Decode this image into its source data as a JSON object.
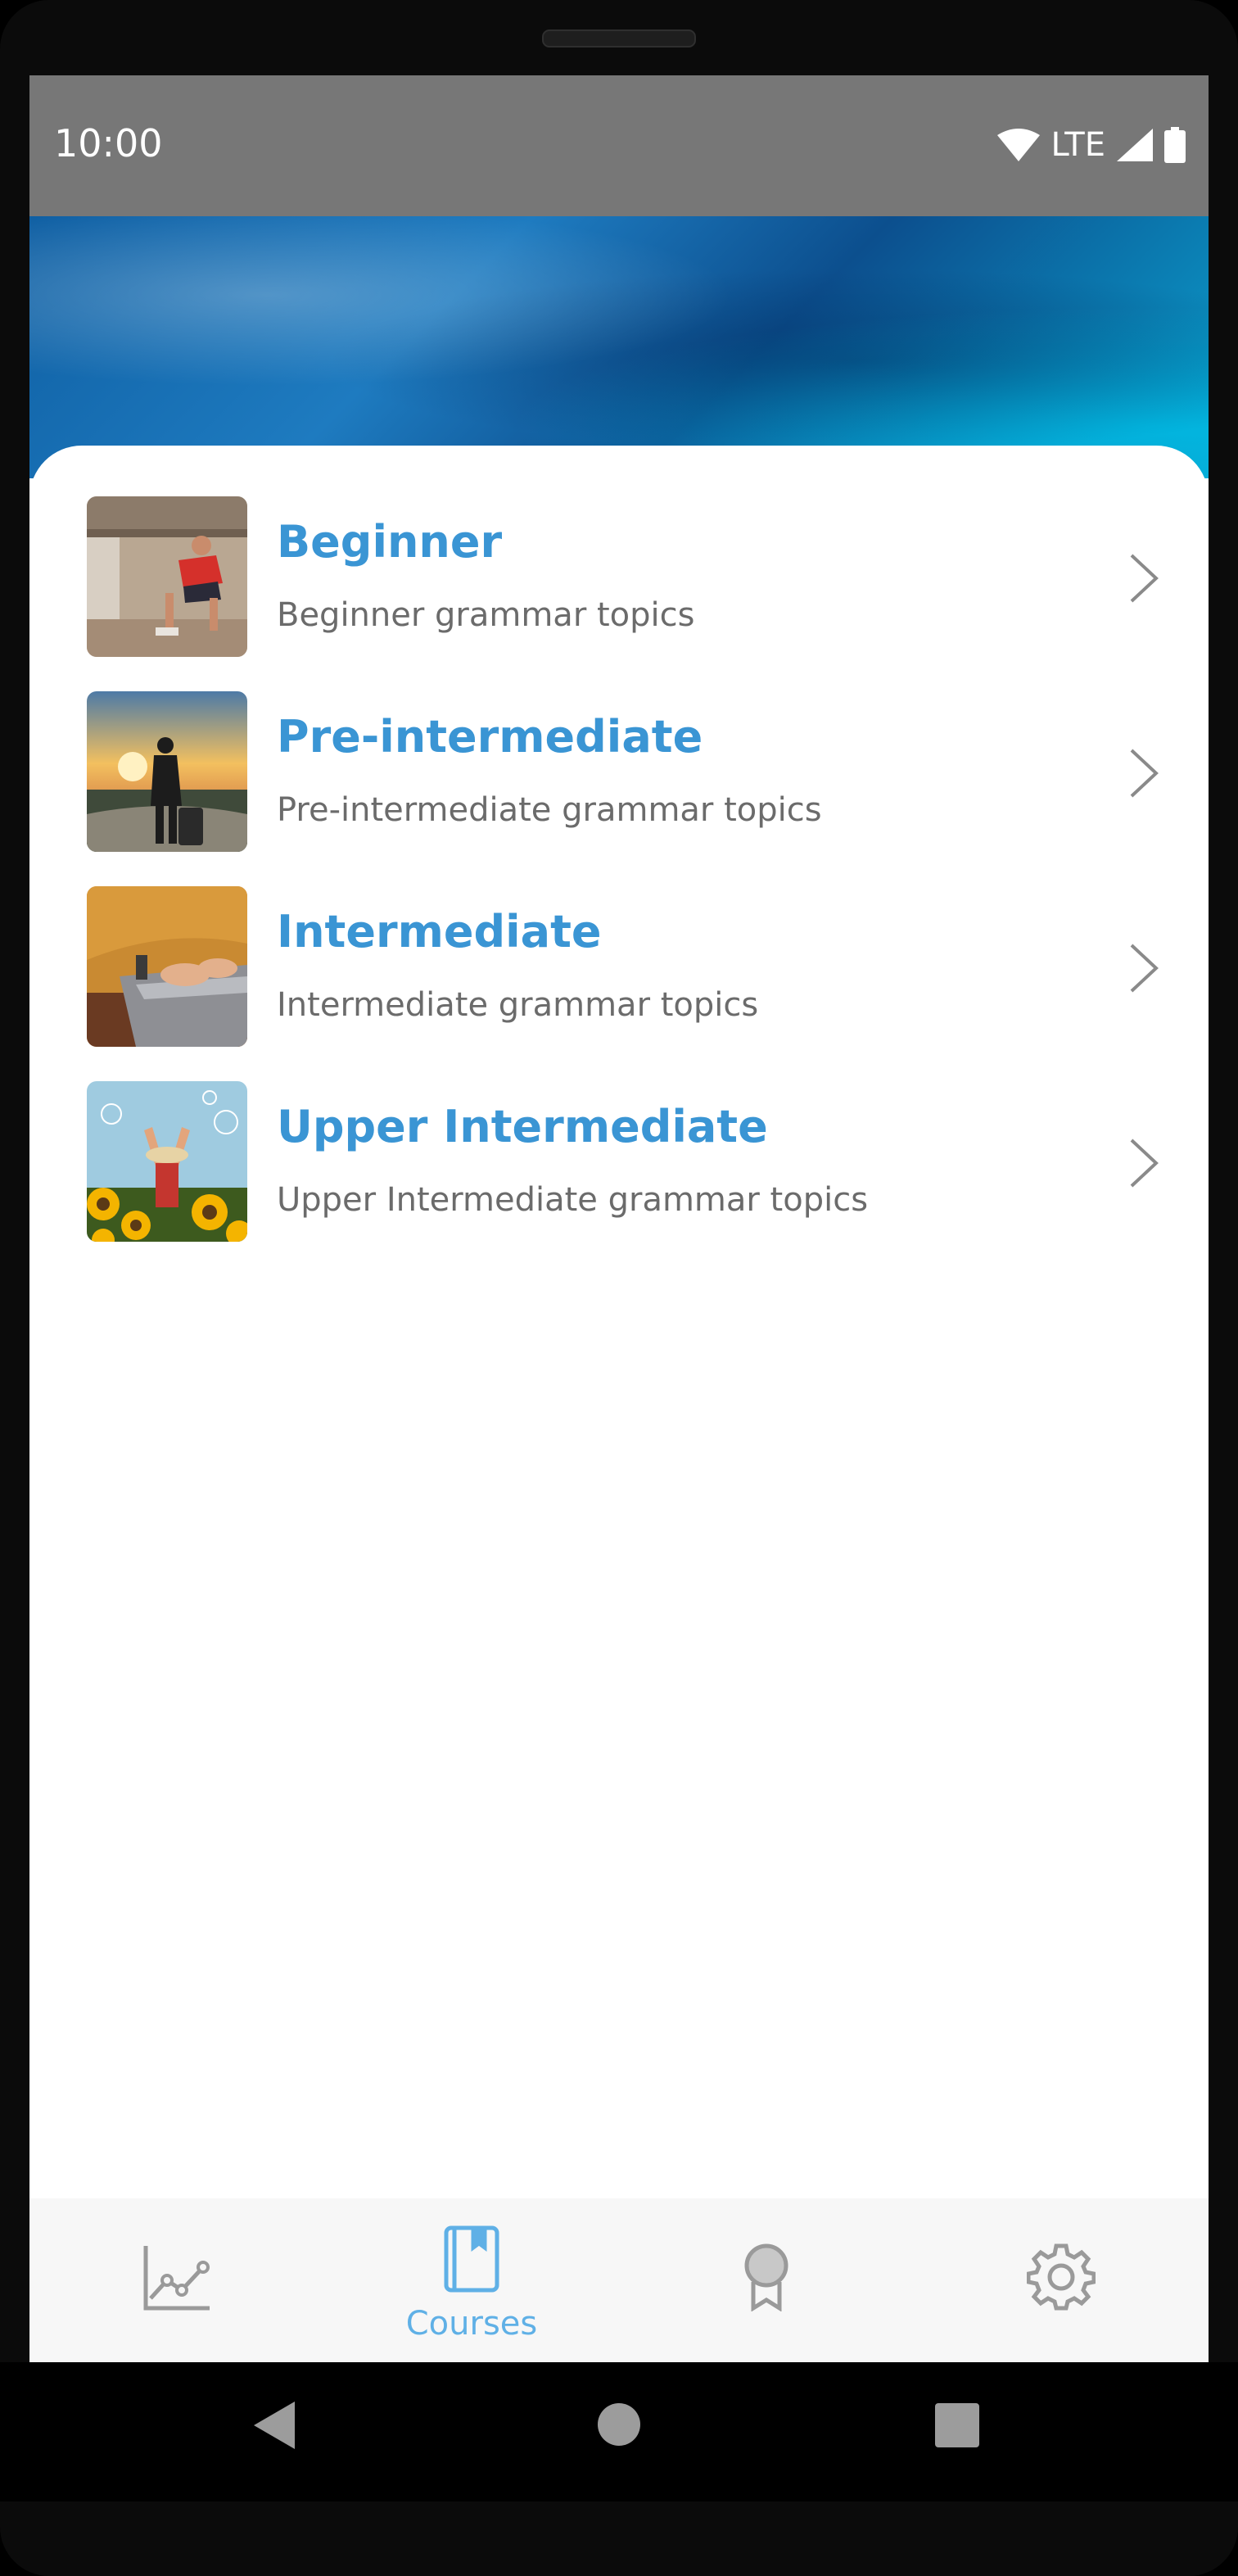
{
  "status_bar": {
    "time": "10:00",
    "network": "LTE"
  },
  "courses": [
    {
      "title": "Beginner",
      "subtitle": "Beginner grammar topics",
      "thumb_icon": "runner-photo-thumbnail"
    },
    {
      "title": "Pre-intermediate",
      "subtitle": "Pre-intermediate grammar topics",
      "thumb_icon": "traveler-sunset-photo-thumbnail"
    },
    {
      "title": "Intermediate",
      "subtitle": "Intermediate grammar topics",
      "thumb_icon": "laptop-sweater-photo-thumbnail"
    },
    {
      "title": "Upper Intermediate",
      "subtitle": "Upper Intermediate grammar topics",
      "thumb_icon": "sunflowers-photo-thumbnail"
    }
  ],
  "bottom_nav": {
    "items": [
      {
        "icon": "progress-chart-icon",
        "label": ""
      },
      {
        "icon": "book-icon",
        "label": "Courses",
        "active": true
      },
      {
        "icon": "award-ribbon-icon",
        "label": ""
      },
      {
        "icon": "gear-icon",
        "label": ""
      }
    ]
  },
  "colors": {
    "accent": "#3a95d4",
    "nav_active": "#5fb0e6",
    "nav_inactive": "#9a9a9a",
    "status_bar": "#777777"
  }
}
